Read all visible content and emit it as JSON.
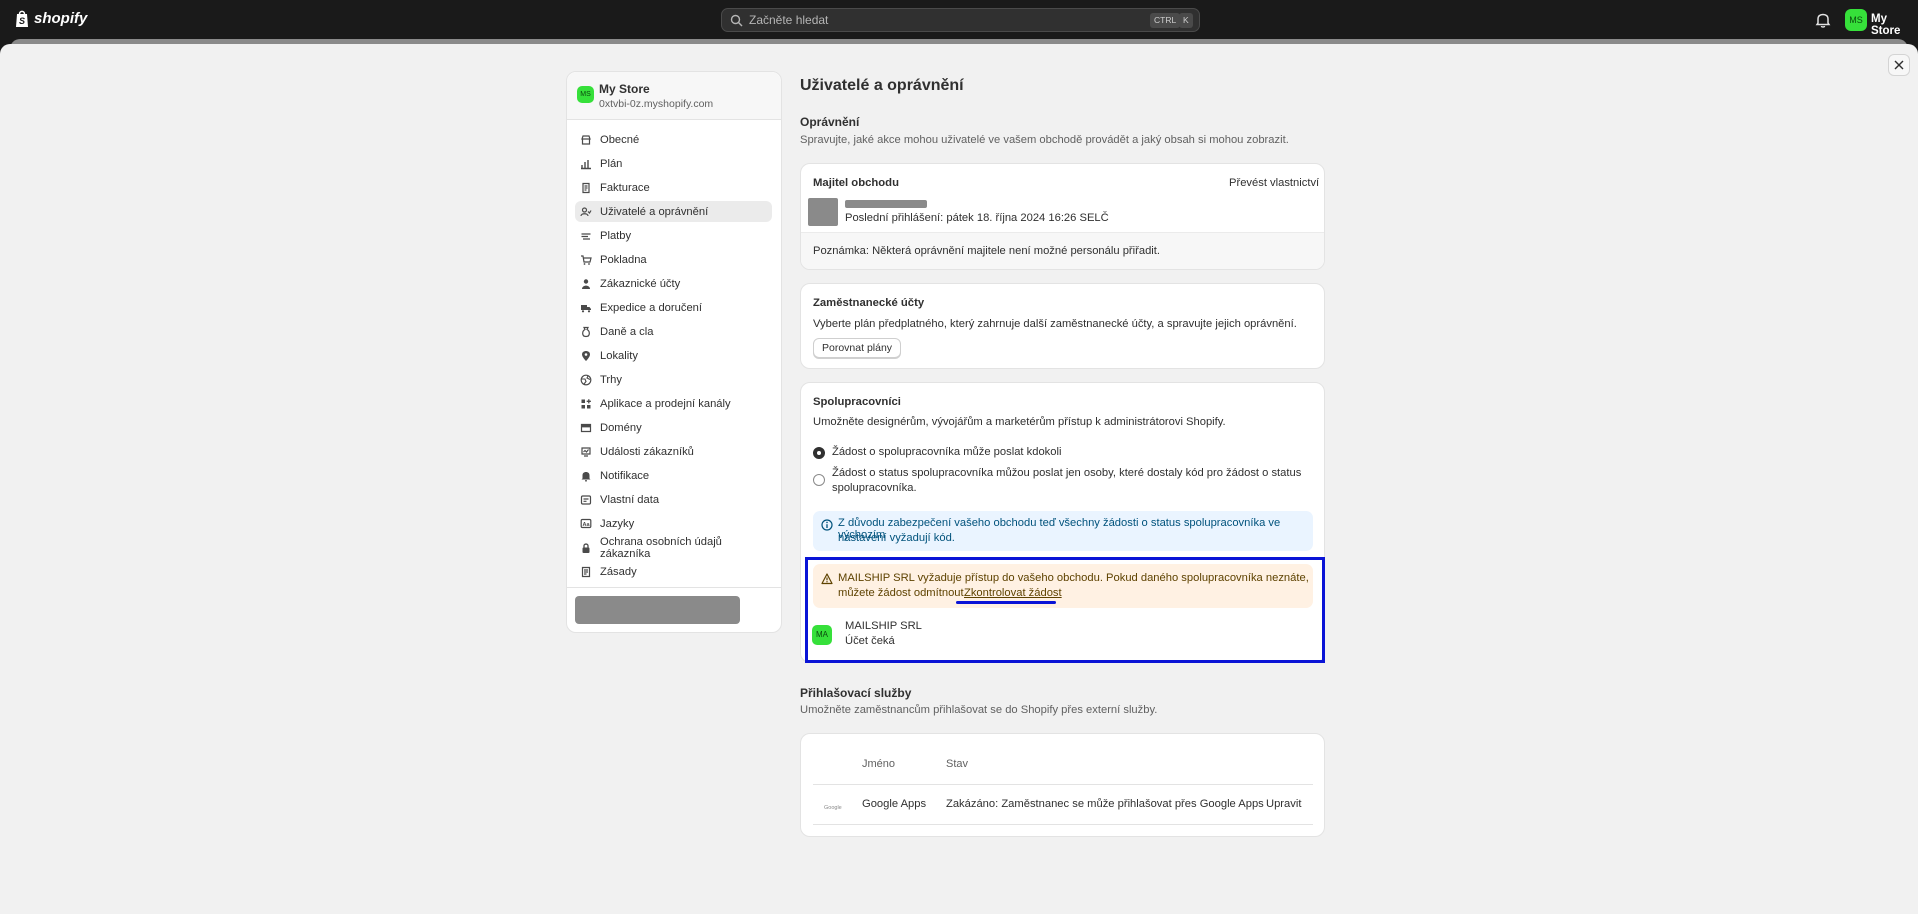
{
  "topbar": {
    "logo_text": "shopify",
    "search_placeholder": "Začněte hledat",
    "shortcut_key1": "CTRL",
    "shortcut_key2": "K",
    "store_initials": "MS",
    "store_name": "My Store"
  },
  "sidebar": {
    "store_initials": "MS",
    "store_name": "My Store",
    "store_domain": "0xtvbi-0z.myshopify.com",
    "items": [
      {
        "label": "Obecné",
        "icon": "store-icon"
      },
      {
        "label": "Plán",
        "icon": "chart-icon"
      },
      {
        "label": "Fakturace",
        "icon": "receipt-icon"
      },
      {
        "label": "Uživatelé a oprávnění",
        "icon": "users-icon",
        "active": true
      },
      {
        "label": "Platby",
        "icon": "payments-icon"
      },
      {
        "label": "Pokladna",
        "icon": "cart-icon"
      },
      {
        "label": "Zákaznické účty",
        "icon": "person-icon"
      },
      {
        "label": "Expedice a doručení",
        "icon": "truck-icon"
      },
      {
        "label": "Daně a cla",
        "icon": "tax-icon"
      },
      {
        "label": "Lokality",
        "icon": "location-icon"
      },
      {
        "label": "Trhy",
        "icon": "globe-icon"
      },
      {
        "label": "Aplikace a prodejní kanály",
        "icon": "apps-icon"
      },
      {
        "label": "Domény",
        "icon": "domain-icon"
      },
      {
        "label": "Události zákazníků",
        "icon": "events-icon"
      },
      {
        "label": "Notifikace",
        "icon": "bell-icon"
      },
      {
        "label": "Vlastní data",
        "icon": "data-icon"
      },
      {
        "label": "Jazyky",
        "icon": "language-icon"
      },
      {
        "label": "Ochrana osobních údajů zákazníka",
        "icon": "lock-icon"
      },
      {
        "label": "Zásady",
        "icon": "policy-icon"
      }
    ]
  },
  "main": {
    "title": "Uživatelé a oprávnění",
    "permissions": {
      "title": "Oprávnění",
      "subtitle": "Spravujte, jaké akce mohou uživatelé ve vašem obchodě provádět a jaký obsah si mohou zobrazit."
    },
    "owner_card": {
      "title": "Majitel obchodu",
      "transfer_link": "Převést vlastnictví",
      "last_login": "Poslední přihlášení: pátek 18. října 2024 16:26 SELČ",
      "note": "Poznámka: Některá oprávnění majitele není možné personálu přiřadit."
    },
    "staff_card": {
      "title": "Zaměstnanecké účty",
      "text": "Vyberte plán předplatného, který zahrnuje další zaměstnanecké účty, a spravujte jejich oprávnění.",
      "button": "Porovnat plány"
    },
    "collab_card": {
      "title": "Spolupracovníci",
      "subtitle": "Umožněte designérům, vývojářům a marketérům přístup k administrátorovi Shopify.",
      "option1": "Žádost o spolupracovníka může poslat kdokoli",
      "option2_line1": "Žádost o status spolupracovníka můžou poslat jen osoby, které dostaly kód pro žádost o status",
      "option2_line2": "spolupracovníka.",
      "info_line1": "Z důvodu zabezpečení vašeho obchodu teď všechny žádosti o status spolupracovníka ve výchozím",
      "info_line2": "nastavení vyžadují kód.",
      "warn_line1": "MAILSHIP SRL vyžaduje přístup do vašeho obchodu. Pokud daného spolupracovníka neznáte,",
      "warn_line2": "můžete žádost odmítnout.",
      "warn_link": "Zkontrolovat žádost",
      "collab_initials": "MA",
      "collab_name": "MAILSHIP SRL",
      "collab_status": "Účet čeká"
    },
    "login_services": {
      "title": "Přihlašovací služby",
      "subtitle": "Umožněte zaměstnancům přihlašovat se do Shopify přes externí služby.",
      "col_name": "Jméno",
      "col_status": "Stav",
      "rows": [
        {
          "logo": "Google",
          "name": "Google Apps",
          "status": "Zakázáno: Zaměstnanec se může přihlašovat přes Google Apps",
          "action": "Upravit"
        }
      ]
    }
  }
}
